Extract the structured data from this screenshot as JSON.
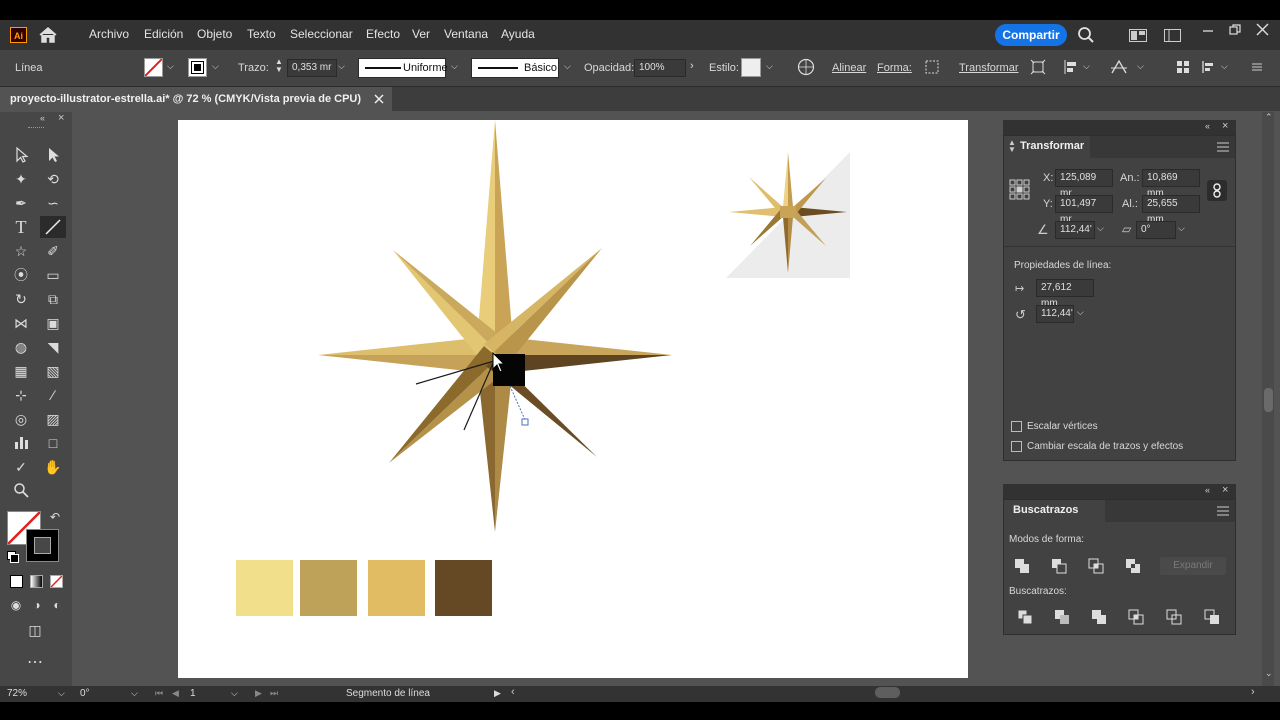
{
  "menu": {
    "app_logo": "Ai",
    "items": [
      "Archivo",
      "Edición",
      "Objeto",
      "Texto",
      "Seleccionar",
      "Efecto",
      "Ver",
      "Ventana",
      "Ayuda"
    ],
    "share_label": "Compartir"
  },
  "control": {
    "object_type": "Línea",
    "stroke_label": "Trazo:",
    "stroke_value": "0,353 mr",
    "profile_label": "Uniforme",
    "brush_label": "Básico",
    "opacity_label": "Opacidad:",
    "opacity_value": "100%",
    "style_label": "Estilo:",
    "align_label": "Alinear",
    "shape_label": "Forma:",
    "transform_label": "Transformar"
  },
  "document": {
    "tab_title": "proyecto-illustrator-estrella.ai* @ 72 % (CMYK/Vista previa de CPU)",
    "swatch_colors": [
      "#f1df8c",
      "#bea25a",
      "#e1bc62",
      "#654924"
    ]
  },
  "transform_panel": {
    "title": "Transformar",
    "x_label": "X:",
    "x_value": "125,089 mr",
    "y_label": "Y:",
    "y_value": "101,497 mr",
    "w_label": "An.:",
    "w_value": "10,869 mm",
    "h_label": "Al.:",
    "h_value": "25,655 mm",
    "angle_value": "112,44'",
    "shear_value": "0°",
    "line_props_label": "Propiedades de línea:",
    "line_length": "27,612 mm",
    "line_angle": "112,44'",
    "scale_corners_label": "Escalar vértices",
    "scale_strokes_label": "Cambiar escala de trazos y efectos"
  },
  "pathfinder_panel": {
    "title": "Buscatrazos",
    "shape_modes_label": "Modos de forma:",
    "expand_label": "Expandir",
    "pathfinders_label": "Buscatrazos:"
  },
  "status": {
    "zoom": "72%",
    "rotation": "0°",
    "artboard": "1",
    "status_text": "Segmento de línea"
  }
}
